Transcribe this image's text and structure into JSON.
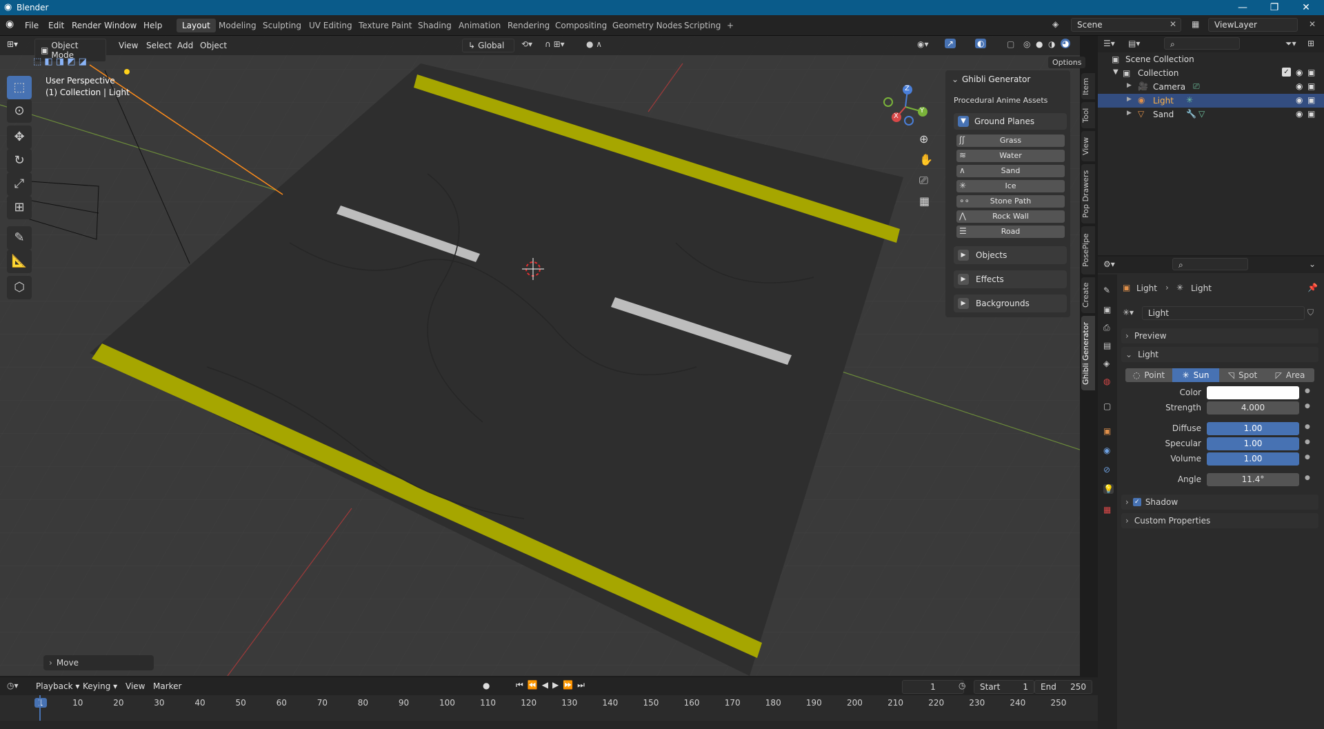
{
  "app": {
    "title": "Blender"
  },
  "menus": [
    "File",
    "Edit",
    "Render",
    "Window",
    "Help"
  ],
  "workspaces": [
    "Layout",
    "Modeling",
    "Sculpting",
    "UV Editing",
    "Texture Paint",
    "Shading",
    "Animation",
    "Rendering",
    "Compositing",
    "Geometry Nodes",
    "Scripting",
    "+"
  ],
  "scene": {
    "scene_name": "Scene",
    "view_layer": "ViewLayer"
  },
  "viewport": {
    "mode": "Object Mode",
    "menus": [
      "View",
      "Select",
      "Add",
      "Object"
    ],
    "orientation": "Global",
    "options_label": "Options",
    "overlay_line1": "User Perspective",
    "overlay_line2": "(1) Collection | Light",
    "last_op": "Move",
    "gizmo": {
      "x": "X",
      "y": "Y",
      "z": "Z"
    }
  },
  "npanel": {
    "header": "Ghibli Generator",
    "subtitle": "Procedural Anime Assets",
    "ground_planes_label": "Ground Planes",
    "buttons": [
      "Grass",
      "Water",
      "Sand",
      "Ice",
      "Stone Path",
      "Rock Wall",
      "Road"
    ],
    "sections": [
      "Objects",
      "Effects",
      "Backgrounds"
    ],
    "tabs": [
      "Item",
      "Tool",
      "View",
      "Pop Drawers",
      "PosePipe",
      "Create",
      "Ghibli Generator"
    ]
  },
  "outliner": {
    "root": "Scene Collection",
    "collection": "Collection",
    "items": [
      "Camera",
      "Light",
      "Sand"
    ],
    "selected": "Light"
  },
  "properties": {
    "breadcrumb_obj": "Light",
    "breadcrumb_data": "Light",
    "datablock": "Light",
    "preview_label": "Preview",
    "light_panel": "Light",
    "types": [
      "Point",
      "Sun",
      "Spot",
      "Area"
    ],
    "active_type": "Sun",
    "fields": [
      {
        "label": "Color",
        "value": ""
      },
      {
        "label": "Strength",
        "value": "4.000"
      },
      {
        "label": "Diffuse",
        "value": "1.00"
      },
      {
        "label": "Specular",
        "value": "1.00"
      },
      {
        "label": "Volume",
        "value": "1.00"
      },
      {
        "label": "Angle",
        "value": "11.4°"
      }
    ],
    "shadow_label": "Shadow",
    "custom_props_label": "Custom Properties"
  },
  "timeline": {
    "menus": [
      "Playback",
      "Keying",
      "View",
      "Marker"
    ],
    "current_frame": "1",
    "start_label": "Start",
    "start": "1",
    "end_label": "End",
    "end": "250",
    "ruler": [
      "1",
      "10",
      "20",
      "30",
      "40",
      "50",
      "60",
      "70",
      "80",
      "90",
      "100",
      "110",
      "120",
      "130",
      "140",
      "150",
      "160",
      "170",
      "180",
      "190",
      "200",
      "210",
      "220",
      "230",
      "240",
      "250"
    ]
  },
  "colors": {
    "accent": "#4772b3",
    "road_yellow": "#a6a600",
    "selected_row": "#334d80"
  }
}
